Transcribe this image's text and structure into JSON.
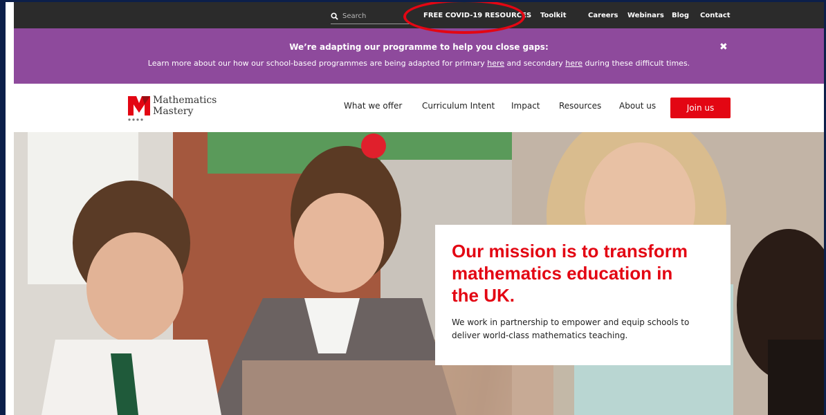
{
  "topbar": {
    "search_placeholder": "Search",
    "links": [
      {
        "label": "FREE COVID-19 RESOURCES"
      },
      {
        "label": "Toolkit"
      },
      {
        "label": "Careers"
      },
      {
        "label": "Webinars"
      },
      {
        "label": "Blog"
      },
      {
        "label": "Contact"
      }
    ]
  },
  "banner": {
    "title": "We’re adapting our programme to help you close gaps:",
    "text_before": "Learn more about our how our school-based programmes are being adapted for primary ",
    "link_primary": "here",
    "text_middle": " and secondary ",
    "link_secondary": "here",
    "text_after": " during these difficult times.",
    "close_symbol": "✖"
  },
  "header": {
    "logo_line1": "Mathematics",
    "logo_line2": "Mastery",
    "nav": [
      {
        "label": "What we offer"
      },
      {
        "label": "Curriculum Intent"
      },
      {
        "label": "Impact"
      },
      {
        "label": "Resources"
      },
      {
        "label": "About us"
      }
    ],
    "join_label": "Join us"
  },
  "hero": {
    "mission_title": "Our mission is to transform mathematics education in the UK.",
    "mission_text": "We work in partnership to empower and equip schools to deliver world-class mathematics teaching."
  },
  "colors": {
    "brand_red": "#e30613",
    "banner_purple": "#8e4a9c",
    "topbar_dark": "#2b2b2b"
  }
}
